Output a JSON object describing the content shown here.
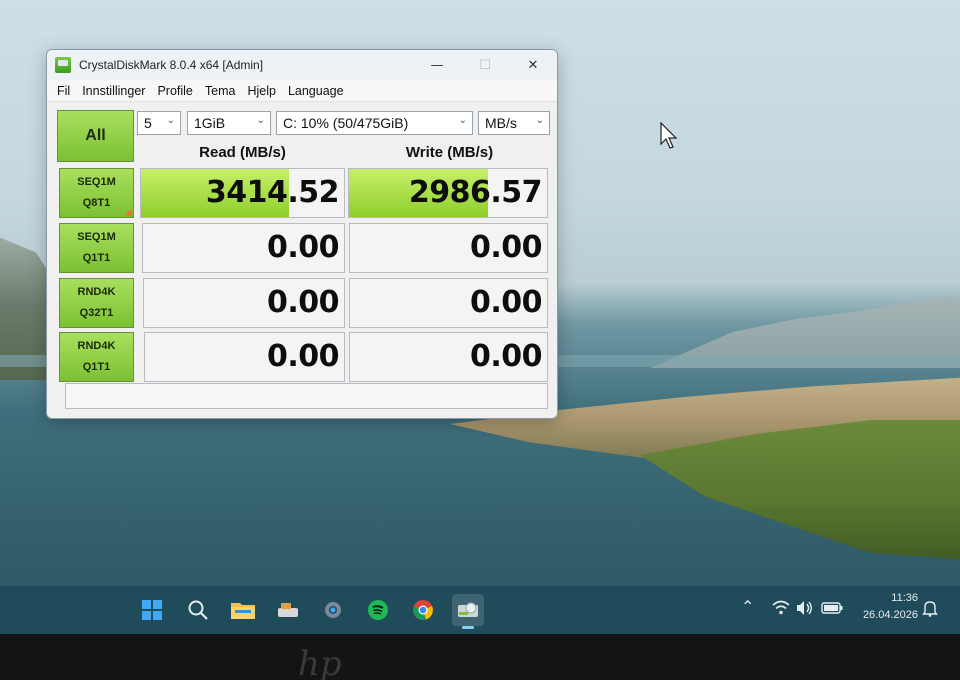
{
  "window": {
    "title": "CrystalDiskMark 8.0.4 x64 [Admin]",
    "controls": {
      "minimize": "—",
      "maximize": "☐",
      "close": "✕"
    }
  },
  "menu": [
    "Fil",
    "Innstillinger",
    "Profile",
    "Tema",
    "Hjelp",
    "Language"
  ],
  "controls": {
    "all_label": "All",
    "count": "5",
    "size": "1GiB",
    "drive": "C: 10% (50/475GiB)",
    "unit": "MB/s"
  },
  "columns": {
    "read": "Read (MB/s)",
    "write": "Write (MB/s)"
  },
  "rows": [
    {
      "line1": "SEQ1M",
      "line2": "Q8T1",
      "read": "3414.52",
      "write": "2986.57",
      "read_fill": 0.73,
      "write_fill": 0.7
    },
    {
      "line1": "SEQ1M",
      "line2": "Q1T1",
      "read": "0.00",
      "write": "0.00",
      "read_fill": 0,
      "write_fill": 0
    },
    {
      "line1": "RND4K",
      "line2": "Q32T1",
      "read": "0.00",
      "write": "0.00",
      "read_fill": 0,
      "write_fill": 0
    },
    {
      "line1": "RND4K",
      "line2": "Q1T1",
      "read": "0.00",
      "write": "0.00",
      "read_fill": 0,
      "write_fill": 0
    }
  ],
  "status_text": "",
  "taskbar": {
    "pinned": [
      "start-icon",
      "search-icon",
      "file-explorer-icon",
      "app-icon",
      "settings-icon",
      "spotify-icon",
      "chrome-icon",
      "crystaldiskmark-icon"
    ],
    "active": "crystaldiskmark-icon"
  },
  "tray": {
    "chevron": "⌃",
    "time": "11:36",
    "date": "26.04.2026"
  },
  "laptop_logo": "hp"
}
